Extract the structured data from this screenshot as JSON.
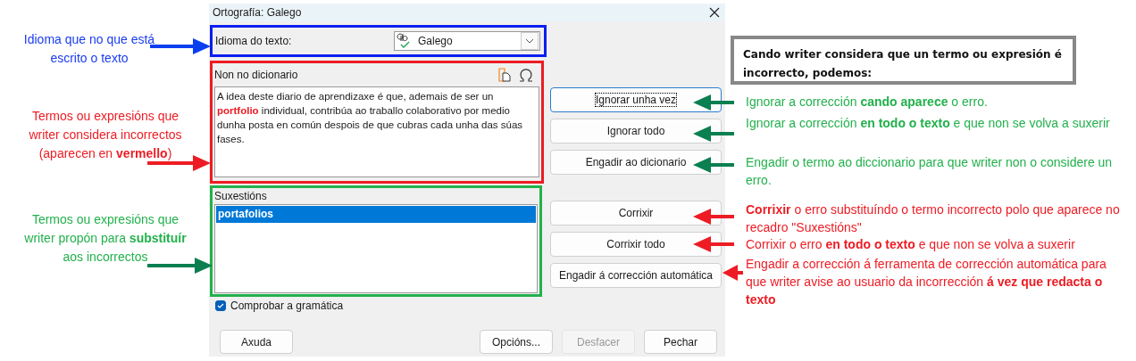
{
  "dialog": {
    "title": "Ortografía: Galego",
    "language": {
      "label": "Idioma do texto:",
      "value": "Galego",
      "color": "#0a1ef0"
    },
    "not_in_dictionary": {
      "label": "Non no dicionario",
      "text": "A idea deste diario de aprendizaxe é que, ademais de ser un **portfolio** individual, contribúa ao traballo colaborativo por medio dunha posta en común despois de que cubras cada unha das súas fases.",
      "color": "#ed1c24"
    },
    "suggestions": {
      "label": "Suxestións",
      "color": "#22b14c",
      "items": [
        {
          "text": "portafolios",
          "selected": true
        }
      ]
    },
    "side_buttons": [
      {
        "label": "Ignorar unha vez",
        "focused": true
      },
      {
        "label": "Ignorar todo",
        "focused": false
      },
      {
        "label": "Engadir ao dicionario",
        "focused": false
      },
      {
        "label": "Corrixir",
        "focused": false
      },
      {
        "label": "Corrixir todo",
        "focused": false
      },
      {
        "label": "Engadir á corrección automática",
        "focused": false
      }
    ],
    "check_grammar": {
      "label": "Comprobar a gramática",
      "checked": true
    },
    "footer_buttons": [
      {
        "label": "Axuda",
        "disabled": false
      },
      {
        "label": "Opcións...",
        "disabled": false
      },
      {
        "label": "Desfacer",
        "disabled": true
      },
      {
        "label": "Pechar",
        "disabled": false
      }
    ]
  },
  "summary_box": {
    "text": "Cando writer considera que un termo ou expresión é incorrecto, podemos:"
  },
  "annotations": [
    {
      "text": "Idioma que no que está escrito o texto",
      "color": "#1a3cf0",
      "arrow": {
        "color": "#0a3ff0"
      }
    },
    {
      "text": "Termos ou expresións que writer considera incorrectos (aparecen en **vermello**)",
      "color": "#ed1c24",
      "arrow": {
        "color": "#ed1c24"
      }
    },
    {
      "text": "Termos ou expresións que writer propón para **substituír** aos incorrectos",
      "color": "#22b14c",
      "arrow": {
        "color": "#0a7f50"
      }
    },
    {
      "text": "Ignorar a corrección **cando aparece** o erro.",
      "color": "#22b14c",
      "arrow": {
        "color": "#0a7f50"
      }
    },
    {
      "text": "Ignorar a corrección **en todo o texto** e que non se volva a suxerir",
      "color": "#22b14c",
      "arrow": {
        "color": "#0a7f50"
      }
    },
    {
      "text": "Engadir o termo ao diccionario para que writer non o considere un erro.",
      "color": "#22b14c",
      "arrow": {
        "color": "#0a7f50"
      }
    },
    {
      "text": "**Corrixir** o erro substituíndo o termo incorrecto polo que aparece no recadro \"Suxestións\"",
      "color": "#ed1c24",
      "arrow": {
        "color": "#ed1c24"
      }
    },
    {
      "text": "Corrixir o erro **en todo o texto** e que non se volva a suxerir",
      "color": "#ed1c24",
      "arrow": {
        "color": "#ed1c24"
      }
    },
    {
      "text": "Engadir a corrección á ferramenta de corrección automática para que writer avise ao usuario da incorrección **á vez que redacta o texto**",
      "color": "#ed1c24",
      "arrow": {
        "color": "#ed1c24"
      }
    }
  ]
}
